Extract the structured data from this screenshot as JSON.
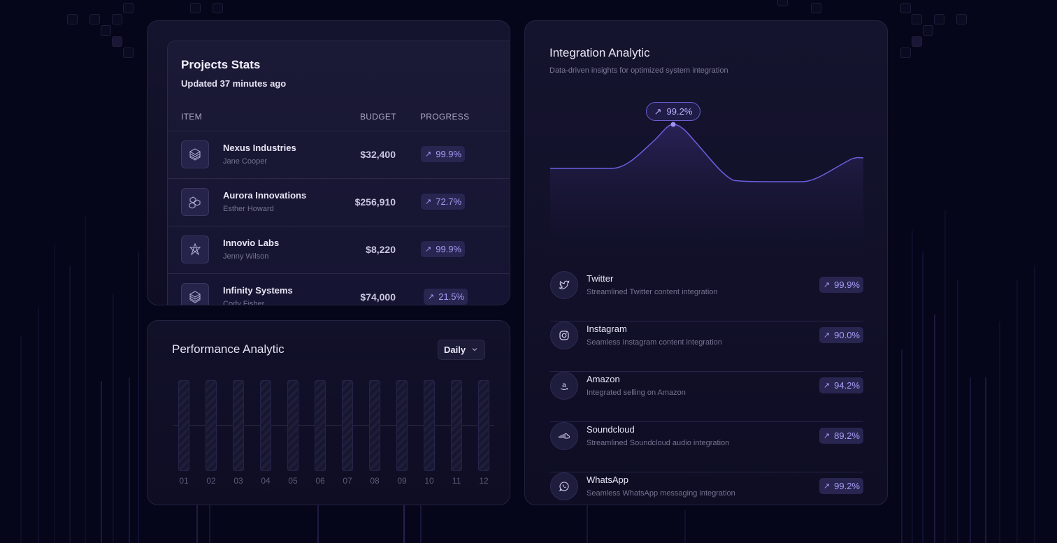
{
  "projects": {
    "title": "Projects Stats",
    "updated": "Updated 37 minutes ago",
    "columns": {
      "item": "ITEM",
      "budget": "BUDGET",
      "progress": "PROGRESS"
    },
    "rows": [
      {
        "name": "Nexus Industries",
        "person": "Jane Cooper",
        "budget": "$32,400",
        "progress": "99.9%",
        "icon": "layers-icon"
      },
      {
        "name": "Aurora Innovations",
        "person": "Esther Howard",
        "budget": "$256,910",
        "progress": "72.7%",
        "icon": "cubes-icon"
      },
      {
        "name": "Innovio Labs",
        "person": "Jenny Wilson",
        "budget": "$8,220",
        "progress": "99.9%",
        "icon": "star-icon"
      },
      {
        "name": "Infinity Systems",
        "person": "Cody Fisher",
        "budget": "$74,000",
        "progress": "21.5%",
        "icon": "layers-icon"
      }
    ]
  },
  "performance": {
    "title": "Performance Analytic",
    "period": "Daily",
    "labels": [
      "01",
      "02",
      "03",
      "04",
      "05",
      "06",
      "07",
      "08",
      "09",
      "10",
      "11",
      "12"
    ]
  },
  "integration": {
    "title": "Integration Analytic",
    "subtitle": "Data-driven insights for optimized system integration",
    "peak": "99.2%",
    "items": [
      {
        "name": "Twitter",
        "desc": "Streamlined Twitter content integration",
        "value": "99.9%",
        "icon": "twitter-icon"
      },
      {
        "name": "Instagram",
        "desc": "Seamless Instagram content integration",
        "value": "90.0%",
        "icon": "instagram-icon"
      },
      {
        "name": "Amazon",
        "desc": "Integrated selling on Amazon",
        "value": "94.2%",
        "icon": "amazon-icon"
      },
      {
        "name": "Soundcloud",
        "desc": "Streamlined Soundcloud audio integration",
        "value": "89.2%",
        "icon": "soundcloud-icon"
      },
      {
        "name": "WhatsApp",
        "desc": "Seamless WhatsApp messaging integration",
        "value": "99.2%",
        "icon": "whatsapp-icon"
      }
    ]
  },
  "colors": {
    "accent": "#a79cf7",
    "background": "#06061a",
    "card": "#15142e"
  }
}
